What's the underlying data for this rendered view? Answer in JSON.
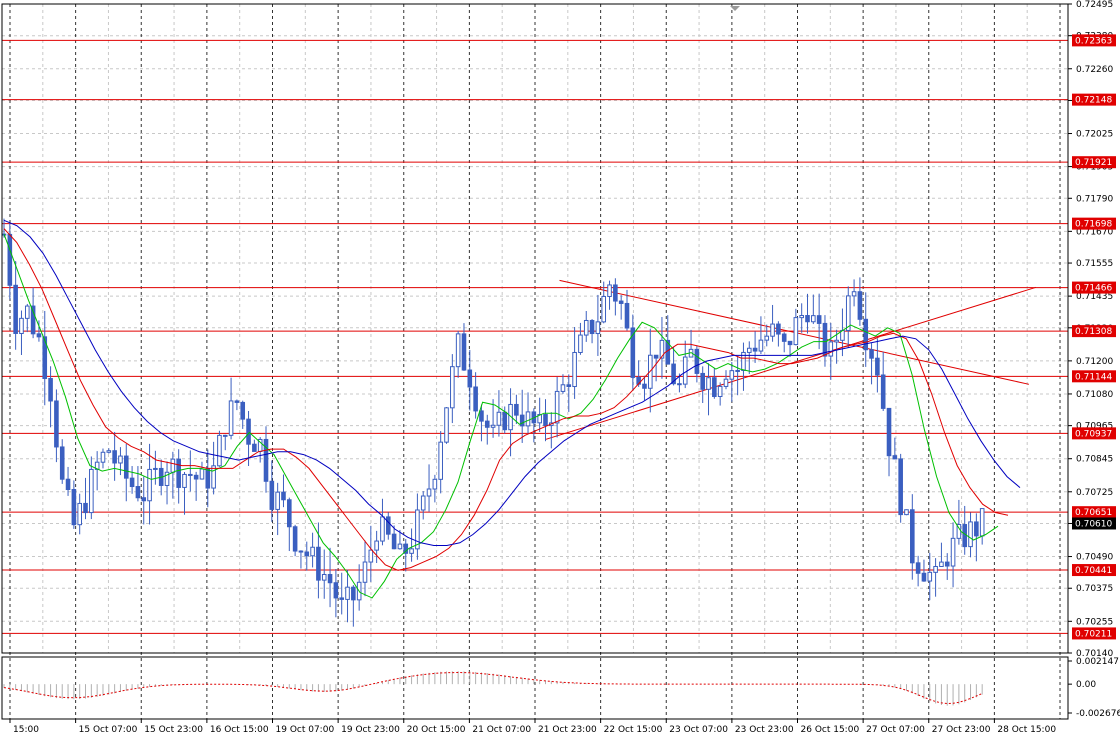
{
  "chart_data": {
    "type": "candlestick",
    "symbol": "AUDUSD",
    "timeframe": "H4",
    "colors": {
      "background": "#ffffff",
      "grid": "#c8c8c8",
      "candle": "#3b5fc0",
      "level_line": "#e00000",
      "level_label_bg": "#e00000",
      "level_label_text": "#ffffff",
      "current_label_bg": "#000000",
      "ma_fast": "#00c000",
      "ma_mid": "#e00000",
      "ma_slow": "#0000c0",
      "trendline": "#e00000",
      "osc_bar": "#b0b0b0",
      "osc_signal": "#e00000"
    },
    "y_axis": {
      "min": 0.7014,
      "max": 0.72495,
      "ticks": [
        "0.72495",
        "0.72380",
        "0.72260",
        "0.72145",
        "0.72025",
        "0.71905",
        "0.71790",
        "0.71670",
        "0.71555",
        "0.71435",
        "0.71320",
        "0.71200",
        "0.71080",
        "0.70965",
        "0.70845",
        "0.70725",
        "0.70610",
        "0.70490",
        "0.70375",
        "0.70255",
        "0.70140"
      ]
    },
    "x_axis": {
      "labels": [
        "15:00",
        "15 Oct 07:00",
        "15 Oct 23:00",
        "16 Oct 15:00",
        "19 Oct 07:00",
        "19 Oct 23:00",
        "20 Oct 15:00",
        "21 Oct 07:00",
        "21 Oct 23:00",
        "22 Oct 15:00",
        "23 Oct 07:00",
        "23 Oct 23:00",
        "26 Oct 15:00",
        "27 Oct 07:00",
        "27 Oct 23:00",
        "28 Oct 15:00"
      ]
    },
    "levels": [
      {
        "price": 0.72363,
        "label": "0.72363"
      },
      {
        "price": 0.72148,
        "label": "0.72148"
      },
      {
        "price": 0.71921,
        "label": "0.71921"
      },
      {
        "price": 0.71698,
        "label": "0.71698"
      },
      {
        "price": 0.71466,
        "label": "0.71466"
      },
      {
        "price": 0.71308,
        "label": "0.71308"
      },
      {
        "price": 0.71144,
        "label": "0.71144"
      },
      {
        "price": 0.70937,
        "label": "0.70937"
      },
      {
        "price": 0.70651,
        "label": "0.70651"
      },
      {
        "price": 0.70441,
        "label": "0.70441"
      },
      {
        "price": 0.70211,
        "label": "0.70211"
      }
    ],
    "current_price": {
      "price": 0.7061,
      "label": "0.70610"
    },
    "close_series": [
      0.7166,
      0.7135,
      0.7138,
      0.7128,
      0.711,
      0.7075,
      0.706,
      0.707,
      0.7082,
      0.7088,
      0.708,
      0.7075,
      0.7072,
      0.7078,
      0.7083,
      0.708,
      0.7079,
      0.7076,
      0.708,
      0.7098,
      0.7105,
      0.7093,
      0.709,
      0.7072,
      0.7067,
      0.7056,
      0.705,
      0.7045,
      0.704,
      0.703,
      0.7034,
      0.7044,
      0.706,
      0.7055,
      0.7048,
      0.7055,
      0.7067,
      0.7082,
      0.7105,
      0.7125,
      0.7115,
      0.71,
      0.7092,
      0.71,
      0.7103,
      0.7098,
      0.7095,
      0.7102,
      0.711,
      0.712,
      0.713,
      0.7136,
      0.7148,
      0.714,
      0.712,
      0.7115,
      0.7125,
      0.7118,
      0.711,
      0.7122,
      0.7115,
      0.7112,
      0.7118,
      0.7117,
      0.7125,
      0.7128,
      0.713,
      0.7124,
      0.7133,
      0.714,
      0.7128,
      0.7122,
      0.7135,
      0.715,
      0.713,
      0.7118,
      0.709,
      0.707,
      0.705,
      0.7045,
      0.704,
      0.705,
      0.7055,
      0.7058,
      0.7061
    ],
    "ma_fast_series": [
      0.7166,
      0.7154,
      0.7142,
      0.7131,
      0.712,
      0.7107,
      0.7092,
      0.7082,
      0.708,
      0.7081,
      0.708,
      0.7079,
      0.7077,
      0.7078,
      0.708,
      0.7081,
      0.7081,
      0.708,
      0.7082,
      0.7089,
      0.7094,
      0.709,
      0.7086,
      0.7078,
      0.707,
      0.7062,
      0.7054,
      0.7049,
      0.7043,
      0.7036,
      0.7034,
      0.704,
      0.7048,
      0.7052,
      0.7054,
      0.7058,
      0.7066,
      0.7076,
      0.7091,
      0.7105,
      0.7104,
      0.7101,
      0.7097,
      0.7099,
      0.7101,
      0.7101,
      0.7099,
      0.7101,
      0.7106,
      0.7113,
      0.7121,
      0.7128,
      0.7134,
      0.7132,
      0.7127,
      0.7122,
      0.7123,
      0.712,
      0.7117,
      0.7119,
      0.7117,
      0.7116,
      0.7117,
      0.7119,
      0.7122,
      0.7125,
      0.7127,
      0.7127,
      0.713,
      0.7133,
      0.7131,
      0.7129,
      0.7132,
      0.713,
      0.7115,
      0.7095,
      0.7078,
      0.7065,
      0.7058,
      0.7055,
      0.7057,
      0.706
    ],
    "ma_mid_series": [
      0.7168,
      0.7163,
      0.7155,
      0.7146,
      0.7135,
      0.7124,
      0.7113,
      0.7104,
      0.7096,
      0.7092,
      0.7089,
      0.7087,
      0.7084,
      0.7083,
      0.7082,
      0.7082,
      0.7081,
      0.7081,
      0.7081,
      0.7084,
      0.7087,
      0.7088,
      0.7088,
      0.7085,
      0.7081,
      0.7075,
      0.7069,
      0.7063,
      0.7057,
      0.7051,
      0.7046,
      0.7044,
      0.7045,
      0.7047,
      0.7049,
      0.7052,
      0.7057,
      0.7064,
      0.7073,
      0.7084,
      0.709,
      0.7093,
      0.7095,
      0.7097,
      0.7099,
      0.71,
      0.71,
      0.7101,
      0.7103,
      0.7107,
      0.7112,
      0.7117,
      0.7123,
      0.7126,
      0.7126,
      0.7125,
      0.7124,
      0.7123,
      0.7121,
      0.7121,
      0.712,
      0.7119,
      0.7119,
      0.712,
      0.7121,
      0.7123,
      0.7125,
      0.7126,
      0.7127,
      0.7129,
      0.713,
      0.7128,
      0.712,
      0.7108,
      0.7094,
      0.7082,
      0.7074,
      0.7068,
      0.7065,
      0.7064
    ],
    "ma_slow_series": [
      0.7171,
      0.7169,
      0.7165,
      0.7159,
      0.7151,
      0.7142,
      0.7133,
      0.7124,
      0.7116,
      0.7109,
      0.7103,
      0.7098,
      0.7094,
      0.7091,
      0.7089,
      0.7087,
      0.7086,
      0.7085,
      0.7084,
      0.7085,
      0.7086,
      0.7087,
      0.7087,
      0.7086,
      0.7084,
      0.7081,
      0.7077,
      0.7073,
      0.7068,
      0.7064,
      0.7059,
      0.7056,
      0.7054,
      0.7053,
      0.7053,
      0.7054,
      0.7057,
      0.7061,
      0.7066,
      0.7072,
      0.7078,
      0.7083,
      0.7087,
      0.7091,
      0.7094,
      0.7097,
      0.7099,
      0.7101,
      0.7103,
      0.7105,
      0.7108,
      0.7111,
      0.7115,
      0.7118,
      0.712,
      0.7121,
      0.7122,
      0.7122,
      0.7122,
      0.7122,
      0.7122,
      0.7122,
      0.7122,
      0.7123,
      0.7124,
      0.7125,
      0.7126,
      0.7127,
      0.7128,
      0.7129,
      0.7128,
      0.7124,
      0.7117,
      0.7108,
      0.7099,
      0.7091,
      0.7084,
      0.7078,
      0.7074
    ],
    "trendlines": [
      {
        "from": {
          "bar": 77,
          "price": 0.70915
        },
        "to": {
          "bar": 147,
          "price": 0.71467
        }
      },
      {
        "from": {
          "bar": 79,
          "price": 0.71492
        },
        "to": {
          "bar": 146,
          "price": 0.71115
        }
      }
    ],
    "oscillator": {
      "ticks": [
        "0.002147",
        "0.00",
        "-0.002676"
      ],
      "min": -0.002676,
      "max": 0.002147
    }
  }
}
